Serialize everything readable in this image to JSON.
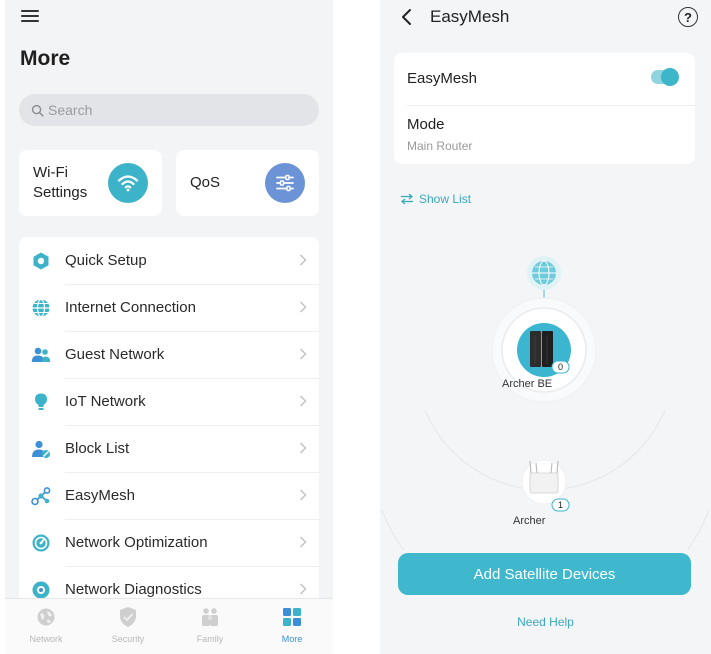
{
  "left": {
    "title": "More",
    "search": {
      "placeholder": "Search"
    },
    "quick": [
      {
        "label": "Wi-Fi Settings",
        "icon": "wifi-icon",
        "color": "#3db3c9"
      },
      {
        "label": "QoS",
        "icon": "sliders-icon",
        "color": "#6b93d6"
      }
    ],
    "items": [
      {
        "label": "Quick Setup",
        "icon": "quick-setup-icon"
      },
      {
        "label": "Internet Connection",
        "icon": "globe-icon"
      },
      {
        "label": "Guest Network",
        "icon": "guest-users-icon"
      },
      {
        "label": "IoT Network",
        "icon": "bulb-icon"
      },
      {
        "label": "Block List",
        "icon": "block-user-icon"
      },
      {
        "label": "EasyMesh",
        "icon": "mesh-icon"
      },
      {
        "label": "Network Optimization",
        "icon": "optimization-icon"
      },
      {
        "label": "Network Diagnostics",
        "icon": "diagnostics-icon"
      }
    ],
    "tabs": [
      {
        "label": "Network",
        "icon": "network-icon",
        "active": false
      },
      {
        "label": "Security",
        "icon": "shield-icon",
        "active": false
      },
      {
        "label": "Family",
        "icon": "family-icon",
        "active": false
      },
      {
        "label": "More",
        "icon": "grid-icon",
        "active": true
      }
    ],
    "accent": "#3db3c9"
  },
  "right": {
    "title": "EasyMesh",
    "easymesh": {
      "label": "EasyMesh",
      "enabled": true
    },
    "mode": {
      "label": "Mode",
      "value": "Main Router"
    },
    "show_list": "Show List",
    "devices": [
      {
        "name": "Archer BE",
        "badge": "0",
        "role": "main-router"
      },
      {
        "name": "Archer",
        "badge": "1",
        "role": "satellite"
      }
    ],
    "add_button": "Add Satellite Devices",
    "need_help": "Need Help",
    "accent": "#3fb8cd"
  }
}
